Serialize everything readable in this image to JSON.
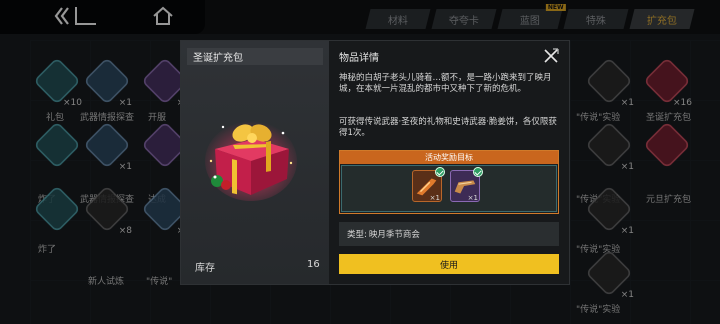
{
  "topbar": {
    "tabs": [
      {
        "label": "材料",
        "active": false
      },
      {
        "label": "夺夸卡",
        "active": false
      },
      {
        "label": "蓝图",
        "active": false,
        "badge": "NEW"
      },
      {
        "label": "特殊",
        "active": false
      },
      {
        "label": "扩充包",
        "active": true
      }
    ]
  },
  "background_grid": {
    "counts": [
      "×10",
      "×1",
      "×1",
      "×1",
      "×16",
      "×1",
      "×1",
      "×1",
      "×1",
      "×8",
      "×1"
    ],
    "labels": [
      "礼包",
      "武器情报探查",
      "开服",
      "圣诞扩充包",
      "武器情报探查",
      "达成",
      "\"传说\"实验",
      "元旦扩充包",
      "新人试炼",
      "\"传说\"",
      "\"传说\"实验",
      "\"传说\"实验",
      "炸了",
      "炸了",
      "\"传说\"实验"
    ]
  },
  "modal": {
    "item_name": "圣诞扩充包",
    "stock_label": "库存",
    "stock_value": "16",
    "details_title": "物品详情",
    "description_1": "神秘的白胡子老头儿骑着…额不，是一路小跑来到了映月城，在本就一片混乱的都市中又种下了新的危机。",
    "description_2": "可获得传说武器·圣夜的礼物和史诗武器·脆姜饼，各仅限获得1次。",
    "reward_header": "活动奖励目标",
    "rewards": [
      {
        "icon": "legendary-weapon-icon",
        "count": "×1",
        "obtained": true
      },
      {
        "icon": "epic-weapon-icon",
        "count": "×1",
        "obtained": true
      }
    ],
    "type_label": "类型:",
    "type_value": "映月季节商会",
    "use_label": "使用"
  }
}
